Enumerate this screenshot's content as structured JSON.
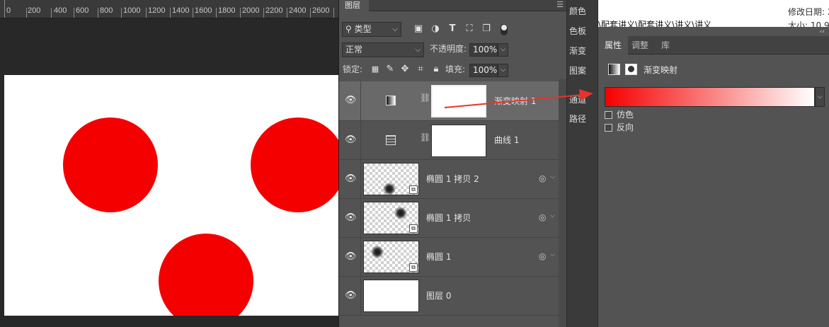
{
  "ruler": {
    "labels": [
      "0",
      "200",
      "400",
      "600",
      "800",
      "1000",
      "1200",
      "1400",
      "1600",
      "1800",
      "2000",
      "2200",
      "2400",
      "2600"
    ]
  },
  "layers_panel": {
    "tab": "图层",
    "menu_icon": "panel-menu-icon",
    "filter": {
      "kind_label": "类型",
      "kind_icon": "search-icon",
      "filter_icons": [
        "pixel-filter-icon",
        "adjustment-filter-icon",
        "type-filter-icon",
        "shape-filter-icon",
        "smart-object-filter-icon"
      ]
    },
    "blend_mode": "正常",
    "opacity_label": "不透明度:",
    "opacity_value": "100%",
    "lock_label": "锁定:",
    "lock_icons": [
      "lock-transparent-icon",
      "lock-image-icon",
      "lock-position-icon",
      "lock-artboard-icon",
      "lock-all-icon"
    ],
    "fill_label": "填充:",
    "fill_value": "100%",
    "layers": [
      {
        "name": "渐变映射 1",
        "type": "adjustment",
        "selected": true
      },
      {
        "name": "曲线 1",
        "type": "adjustment",
        "selected": false
      },
      {
        "name": "椭圆 1 拷贝 2",
        "type": "smart-object",
        "selected": false
      },
      {
        "name": "椭圆 1 拷贝",
        "type": "smart-object",
        "selected": false
      },
      {
        "name": "椭圆 1",
        "type": "smart-object",
        "selected": false
      },
      {
        "name": "图层 0",
        "type": "pixel",
        "selected": false
      }
    ]
  },
  "side_dock": {
    "items": [
      "颜色",
      "色板",
      "渐变",
      "图案",
      "通道",
      "路径"
    ]
  },
  "explorer_strip": {
    "path": "\\配套讲义\\配套讲义\\讲义\\讲义",
    "modified": "修改日期: 2",
    "size": "大小: 10.9"
  },
  "properties_panel": {
    "tabs": [
      "属性",
      "调整",
      "库"
    ],
    "active_tab": "属性",
    "title": "渐变映射",
    "gradient": {
      "from": "#f50000",
      "to": "#ffffff"
    },
    "dither_label": "仿色",
    "reverse_label": "反向"
  },
  "canvas": {
    "background": "#ffffff",
    "circle_color": "#f50000"
  },
  "colors": {
    "panel": "#535353",
    "selected_layer": "#696969",
    "annotation_arrow": "#e8322c"
  }
}
